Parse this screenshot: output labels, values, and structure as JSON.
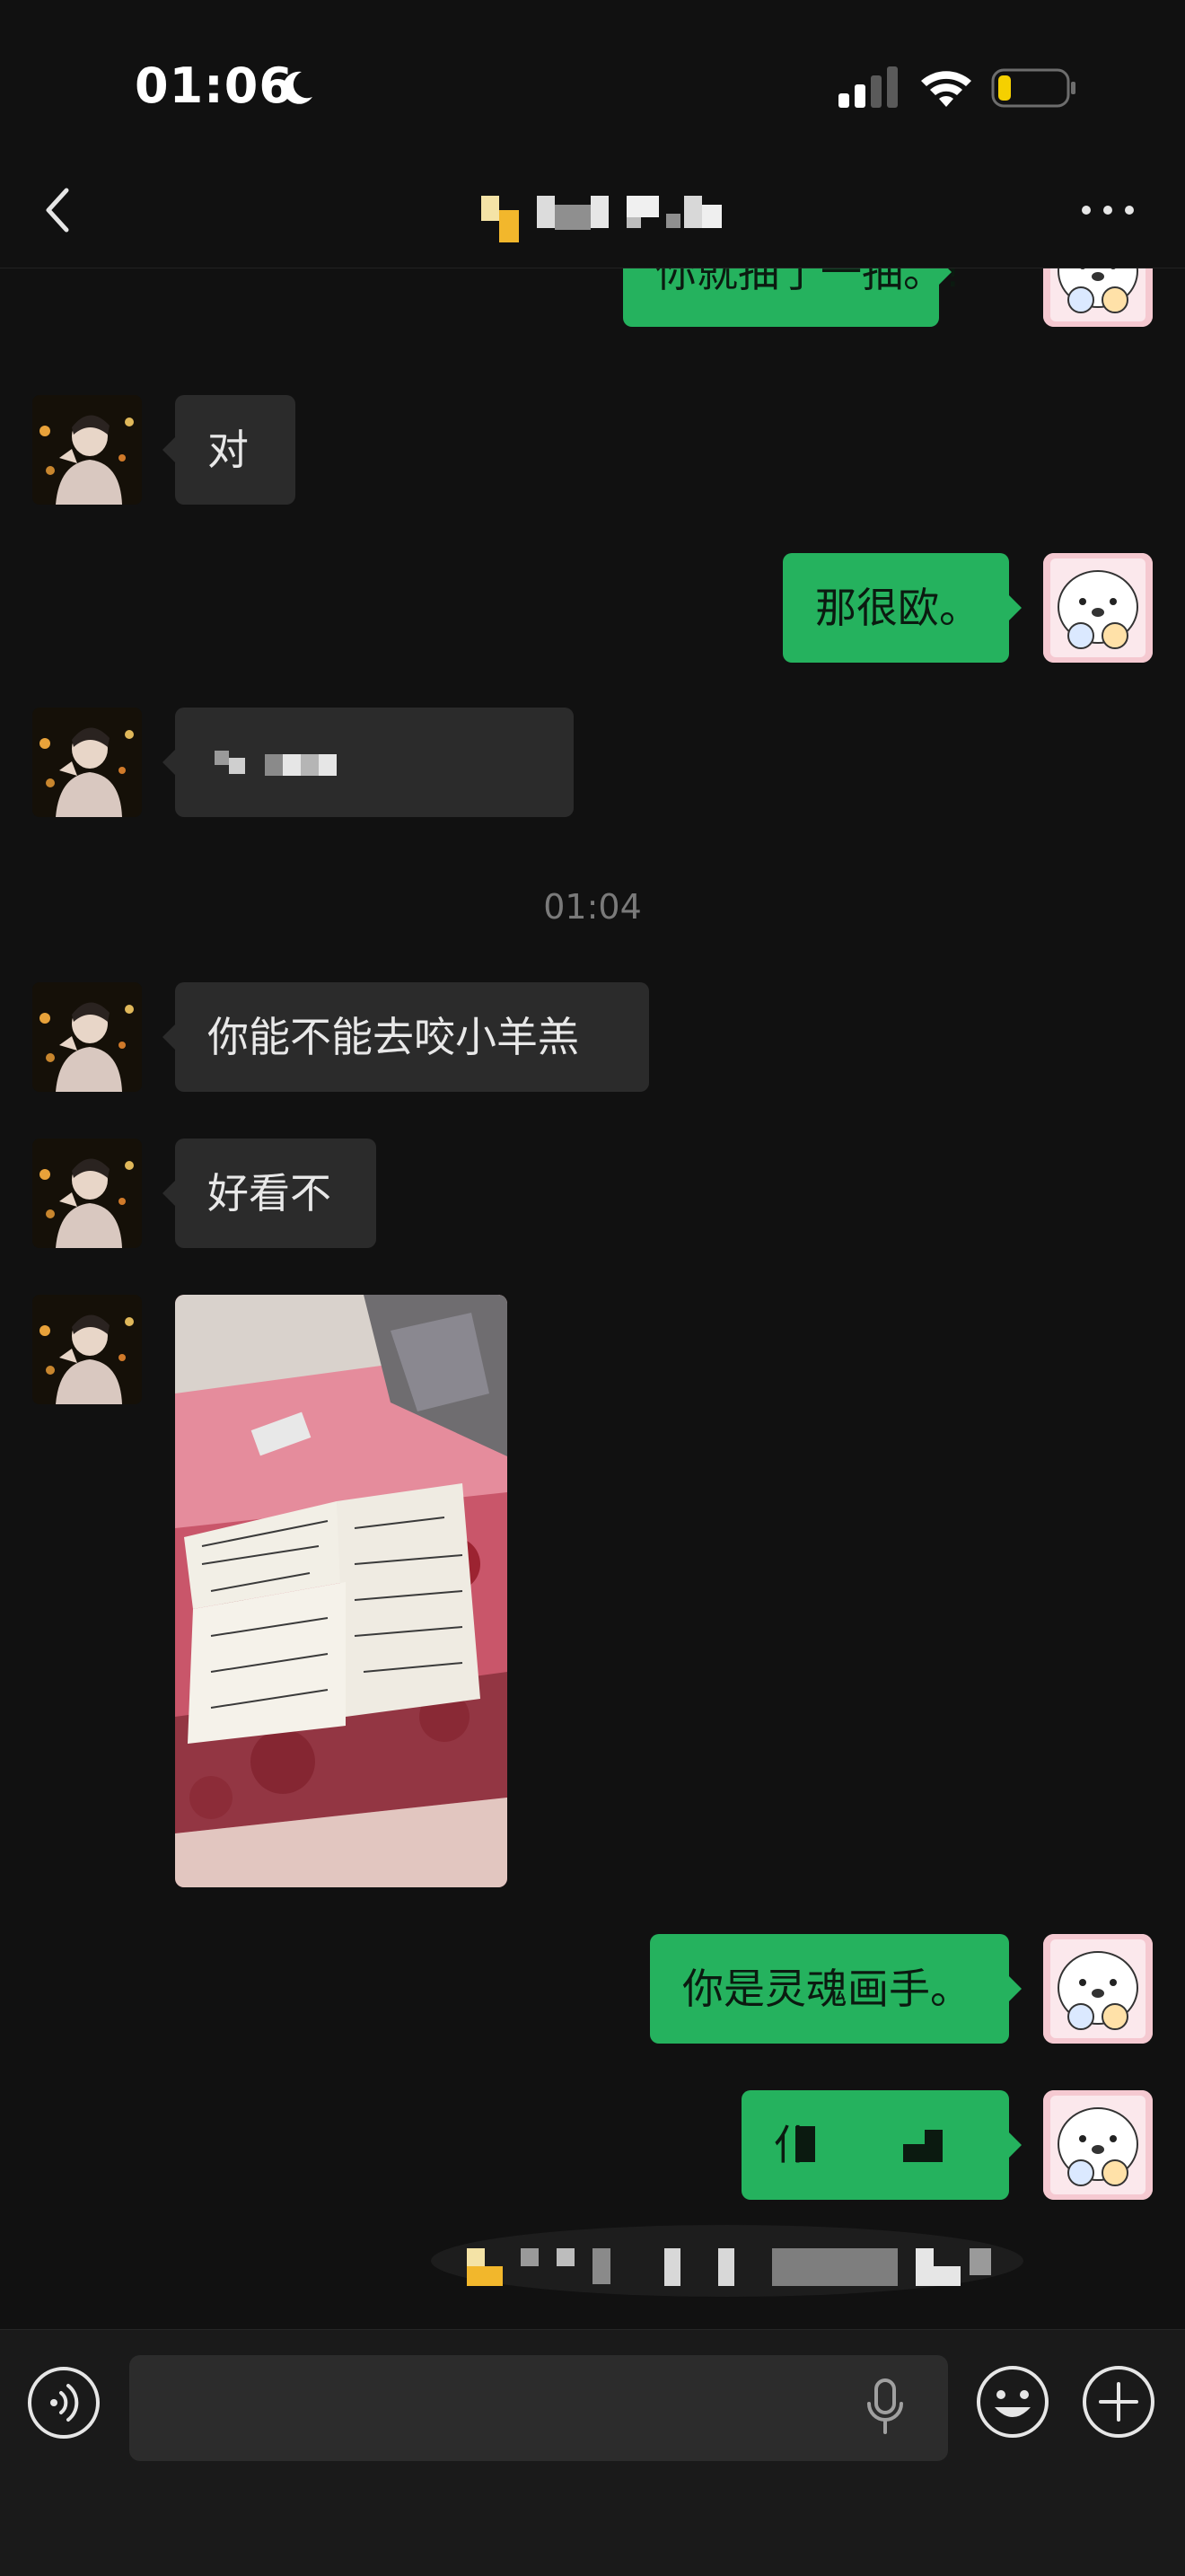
{
  "status_bar": {
    "time": "01:06",
    "icons": [
      "moon-icon",
      "cellular-signal-icon",
      "wifi-icon",
      "battery-icon"
    ],
    "battery_level": 0.2,
    "battery_color": "#f5d000"
  },
  "nav": {
    "back_icon": "chevron-left-icon",
    "more_icon": "more-dots-icon"
  },
  "messages": [
    {
      "direction": "out",
      "text": "你就抽了一抽。!"
    },
    {
      "direction": "in",
      "text": "对"
    },
    {
      "direction": "out",
      "text": "那很欧。"
    },
    {
      "direction": "in",
      "text": ""
    },
    {
      "direction": "time",
      "text": "01:04"
    },
    {
      "direction": "in",
      "text": "你能不能去咬小羊羔"
    },
    {
      "direction": "in",
      "text": "好看不"
    },
    {
      "direction": "in",
      "type": "image"
    },
    {
      "direction": "out",
      "text": "你是灵魂画手。"
    },
    {
      "direction": "out",
      "text": "仆"
    }
  ],
  "input_bar": {
    "placeholder": "",
    "icons": [
      "voice-icon",
      "microphone-icon",
      "emoji-icon",
      "plus-icon"
    ]
  },
  "colors": {
    "background": "#111111",
    "incoming_bubble": "#2b2b2b",
    "outgoing_bubble": "#25b25e",
    "timestamp": "#7a7a7a"
  }
}
